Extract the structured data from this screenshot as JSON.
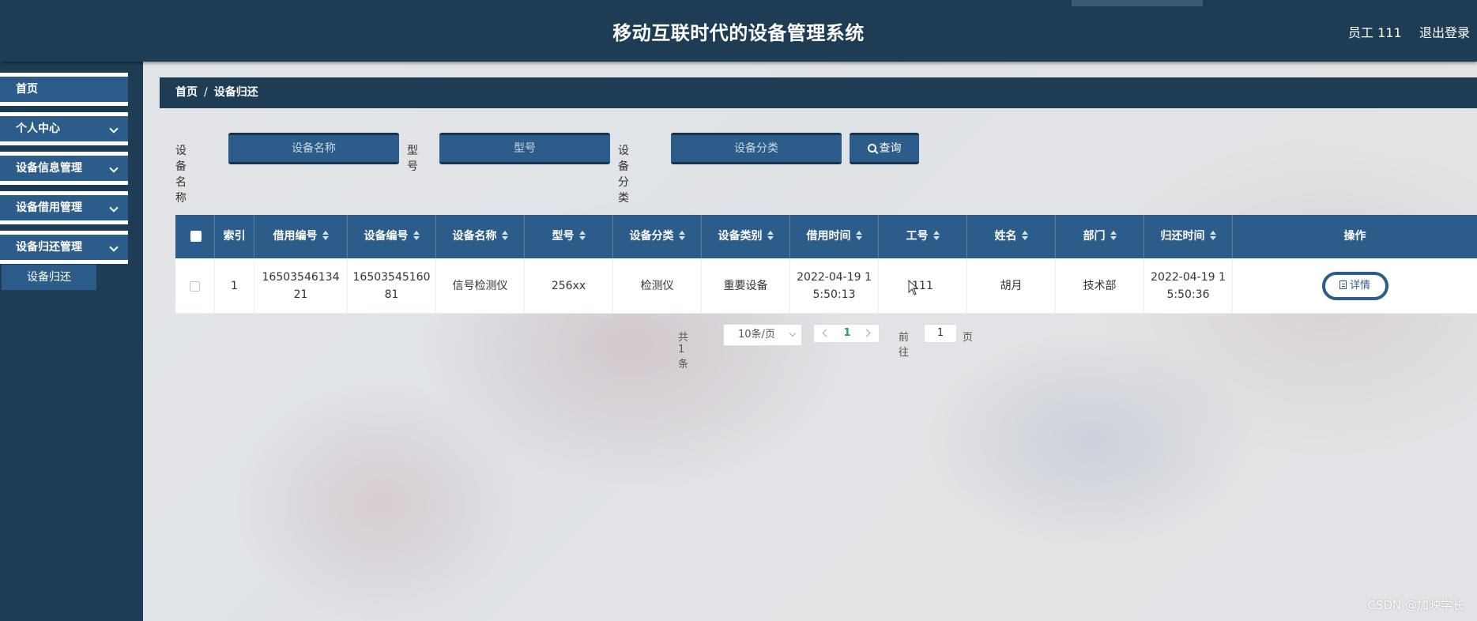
{
  "header": {
    "title": "移动互联时代的设备管理系统",
    "user": "员工 111",
    "logout": "退出登录"
  },
  "sidebar": {
    "items": [
      {
        "label": "首页",
        "has_chevron": false
      },
      {
        "label": "个人中心",
        "has_chevron": true
      },
      {
        "label": "设备信息管理",
        "has_chevron": true
      },
      {
        "label": "设备借用管理",
        "has_chevron": true
      },
      {
        "label": "设备归还管理",
        "has_chevron": true
      }
    ],
    "submenu": {
      "label": "设备归还"
    }
  },
  "breadcrumb": {
    "home": "首页",
    "separator": "/",
    "current": "设备归还"
  },
  "search": {
    "device_name_label": "设备名称",
    "device_name_placeholder": "设备名称",
    "model_label": "型号",
    "model_placeholder": "型号",
    "category_label": "设备分类",
    "category_placeholder": "设备分类",
    "query_button": "查询"
  },
  "table": {
    "columns": [
      "索引",
      "借用编号",
      "设备编号",
      "设备名称",
      "型号",
      "设备分类",
      "设备类别",
      "借用时间",
      "工号",
      "姓名",
      "部门",
      "归还时间",
      "操作"
    ],
    "rows": [
      {
        "index": "1",
        "borrow_no": "1650354613421",
        "device_no": "1650354516081",
        "device_name": "信号检测仪",
        "model": "256xx",
        "category": "检测仪",
        "type": "重要设备",
        "borrow_time": "2022-04-19 15:50:13",
        "job_no": "111",
        "name": "胡月",
        "dept": "技术部",
        "return_time": "2022-04-19 15:50:36",
        "action": "详情"
      }
    ]
  },
  "pagination": {
    "total": "共 1 条",
    "page_size": "10条/页",
    "current_page": "1",
    "goto_label": "前往",
    "goto_value": "1",
    "page_suffix": "页"
  },
  "watermark": "CSDN @加映学长",
  "colors": {
    "header_bg": "#1e3d55",
    "accent_blue": "#2c5c89",
    "current_page": "#1aa06d"
  }
}
